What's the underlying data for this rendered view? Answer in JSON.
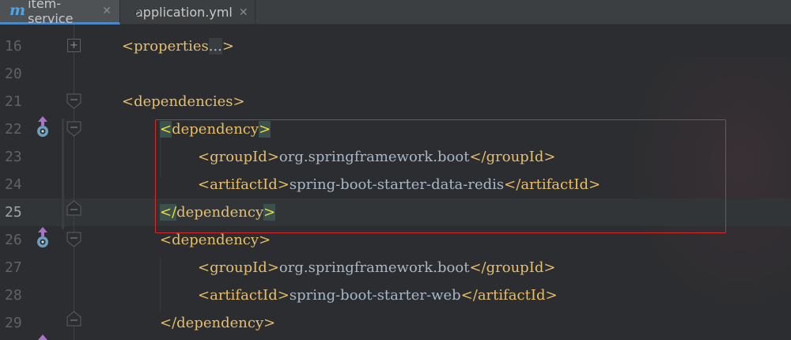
{
  "tabs": [
    {
      "label": "item-service",
      "icon": "maven-m-icon",
      "active": true
    },
    {
      "label": "application.yml",
      "icon": "spring-leaf-icon",
      "active": false
    }
  ],
  "lines": [
    {
      "no": "16",
      "tokens": [
        [
          "br",
          "<"
        ],
        [
          "tag",
          "properties"
        ],
        [
          "fold",
          "..."
        ],
        [
          "br",
          ">"
        ]
      ]
    },
    {
      "no": "20",
      "tokens": []
    },
    {
      "no": "21",
      "tokens": [
        [
          "br",
          "<"
        ],
        [
          "tag",
          "dependencies"
        ],
        [
          "br",
          ">"
        ]
      ]
    },
    {
      "no": "22",
      "tokens": [
        [
          "match",
          "<"
        ],
        [
          "tag",
          "dependency"
        ],
        [
          "match",
          ">"
        ]
      ]
    },
    {
      "no": "23",
      "tokens": [
        [
          "br",
          "<"
        ],
        [
          "tag",
          "groupId"
        ],
        [
          "br",
          ">"
        ],
        [
          "txt",
          "org.springframework.boot"
        ],
        [
          "br",
          "</"
        ],
        [
          "tag",
          "groupId"
        ],
        [
          "br",
          ">"
        ]
      ]
    },
    {
      "no": "24",
      "tokens": [
        [
          "br",
          "<"
        ],
        [
          "tag",
          "artifactId"
        ],
        [
          "br",
          ">"
        ],
        [
          "txt",
          "spring-boot-starter-data-redis"
        ],
        [
          "br",
          "</"
        ],
        [
          "tag",
          "artifactId"
        ],
        [
          "br",
          ">"
        ]
      ]
    },
    {
      "no": "25",
      "tokens": [
        [
          "match",
          "</"
        ],
        [
          "tag",
          "dependency"
        ],
        [
          "match",
          ">"
        ]
      ]
    },
    {
      "no": "26",
      "tokens": [
        [
          "br",
          "<"
        ],
        [
          "tag",
          "dependency"
        ],
        [
          "br",
          ">"
        ]
      ]
    },
    {
      "no": "27",
      "tokens": [
        [
          "br",
          "<"
        ],
        [
          "tag",
          "groupId"
        ],
        [
          "br",
          ">"
        ],
        [
          "txt",
          "org.springframework.boot"
        ],
        [
          "br",
          "</"
        ],
        [
          "tag",
          "groupId"
        ],
        [
          "br",
          ">"
        ]
      ]
    },
    {
      "no": "28",
      "tokens": [
        [
          "br",
          "<"
        ],
        [
          "tag",
          "artifactId"
        ],
        [
          "br",
          ">"
        ],
        [
          "txt",
          "spring-boot-starter-web"
        ],
        [
          "br",
          "</"
        ],
        [
          "tag",
          "artifactId"
        ],
        [
          "br",
          ">"
        ]
      ]
    },
    {
      "no": "29",
      "tokens": [
        [
          "br",
          "</"
        ],
        [
          "tag",
          "dependency"
        ],
        [
          "br",
          ">"
        ]
      ]
    }
  ],
  "colors": {
    "tag": "#e8bf6a",
    "text": "#a9b7c6",
    "line_number": "#606366",
    "highlight_border": "#d9292b",
    "tab_accent": "#4a88c7"
  }
}
